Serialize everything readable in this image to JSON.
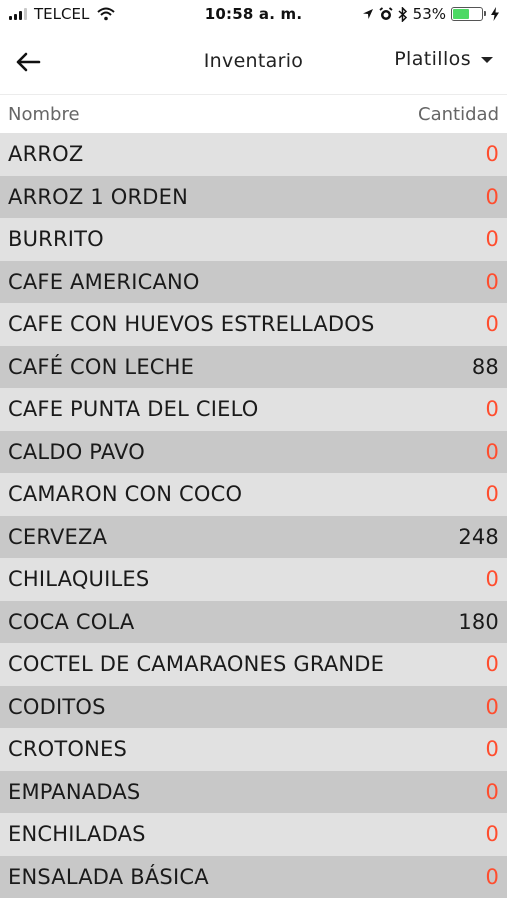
{
  "status_bar": {
    "carrier": "TELCEL",
    "time": "10:58 a. m.",
    "battery_percent": "53%",
    "battery_level": 0.53,
    "icons": [
      "signal-icon",
      "wifi-icon",
      "location-icon",
      "alarm-icon",
      "bluetooth-icon",
      "battery-icon",
      "charging-icon"
    ]
  },
  "nav": {
    "back_icon": "back-arrow-icon",
    "title": "Inventario",
    "dropdown_label": "Platillos"
  },
  "columns": {
    "name": "Nombre",
    "quantity": "Cantidad"
  },
  "colors": {
    "zero_quantity": "#ff4d2e",
    "row_light": "#e1e1e1",
    "row_dark": "#c8c8c8"
  },
  "items": [
    {
      "name": "ARROZ",
      "quantity": "0"
    },
    {
      "name": "ARROZ 1 ORDEN",
      "quantity": "0"
    },
    {
      "name": "BURRITO",
      "quantity": "0"
    },
    {
      "name": "CAFE AMERICANO",
      "quantity": "0"
    },
    {
      "name": "CAFE CON HUEVOS ESTRELLADOS",
      "quantity": "0"
    },
    {
      "name": "CAFÉ CON LECHE",
      "quantity": "88"
    },
    {
      "name": "CAFE PUNTA DEL CIELO",
      "quantity": "0"
    },
    {
      "name": "CALDO PAVO",
      "quantity": "0"
    },
    {
      "name": "CAMARON CON COCO",
      "quantity": "0"
    },
    {
      "name": "CERVEZA",
      "quantity": "248"
    },
    {
      "name": "CHILAQUILES",
      "quantity": "0"
    },
    {
      "name": "COCA COLA",
      "quantity": "180"
    },
    {
      "name": "COCTEL DE CAMARAONES GRANDE",
      "quantity": "0"
    },
    {
      "name": "CODITOS",
      "quantity": "0"
    },
    {
      "name": "CROTONES",
      "quantity": "0"
    },
    {
      "name": "EMPANADAS",
      "quantity": "0"
    },
    {
      "name": "ENCHILADAS",
      "quantity": "0"
    },
    {
      "name": "ENSALADA BÁSICA",
      "quantity": "0"
    }
  ]
}
